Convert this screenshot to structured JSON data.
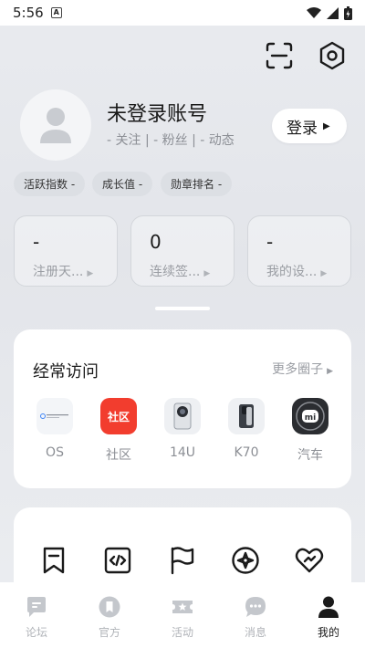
{
  "status_bar": {
    "time": "5:56",
    "app_badge": "A"
  },
  "header": {
    "scan_icon": "scan-icon",
    "settings_icon": "settings-icon"
  },
  "profile": {
    "username": "未登录账号",
    "stats_line": "- 关注 | - 粉丝 | - 动态",
    "login_label": "登录"
  },
  "chips": [
    "活跃指数 -",
    "成长值 -",
    "勋章排名 -"
  ],
  "stat_cards": [
    {
      "value": "-",
      "label": "注册天..."
    },
    {
      "value": "0",
      "label": "连续签..."
    },
    {
      "value": "-",
      "label": "我的设..."
    }
  ],
  "frequent": {
    "title": "经常访问",
    "more": "更多圈子",
    "items": [
      {
        "label": "OS",
        "icon": "xiaomi-hyperos-icon"
      },
      {
        "label": "社区",
        "icon": "community-icon",
        "icon_text": "社区"
      },
      {
        "label": "14U",
        "icon": "phone-14u-icon"
      },
      {
        "label": "K70",
        "icon": "phone-k70-icon"
      },
      {
        "label": "汽车",
        "icon": "xiaomi-auto-icon"
      }
    ]
  },
  "tools": [
    "bookmark-icon",
    "code-icon",
    "flag-icon",
    "compass-icon",
    "heart-icon"
  ],
  "bottom_nav": [
    {
      "label": "论坛",
      "icon": "forum-icon",
      "active": false
    },
    {
      "label": "官方",
      "icon": "official-icon",
      "active": false
    },
    {
      "label": "活动",
      "icon": "activity-icon",
      "active": false
    },
    {
      "label": "消息",
      "icon": "message-icon",
      "active": false
    },
    {
      "label": "我的",
      "icon": "profile-icon",
      "active": true
    }
  ],
  "colors": {
    "accent_red": "#f23d2e",
    "background": "#e8eaee",
    "card": "#ffffff"
  }
}
